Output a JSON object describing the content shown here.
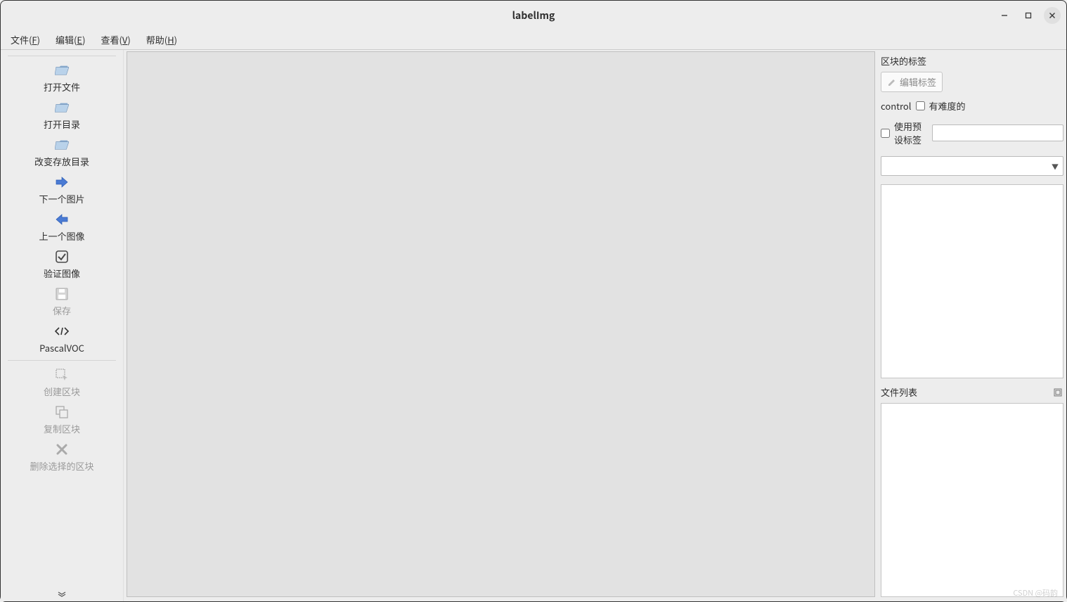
{
  "window": {
    "title": "labelImg"
  },
  "menubar": {
    "file": {
      "label": "文件(",
      "mnemonic": "F",
      "close": ")"
    },
    "edit": {
      "label": "编辑(",
      "mnemonic": "E",
      "close": ")"
    },
    "view": {
      "label": "查看(",
      "mnemonic": "V",
      "close": ")"
    },
    "help": {
      "label": "帮助(",
      "mnemonic": "H",
      "close": ")"
    }
  },
  "toolbar": {
    "open_file": "打开文件",
    "open_dir": "打开目录",
    "change_save_dir": "改变存放目录",
    "next_image": "下一个图片",
    "prev_image": "上一个图像",
    "verify_image": "验证图像",
    "save": "保存",
    "format": "PascalVOC",
    "create_box": "创建区块",
    "duplicate_box": "复制区块",
    "delete_box": "删除选择的区块"
  },
  "right_panel": {
    "box_labels_title": "区块的标签",
    "edit_label": "编辑标签",
    "difficult": "有难度的",
    "use_default_label": "使用预设标签",
    "default_label_value": "",
    "dropdown_value": "",
    "file_list_title": "文件列表"
  },
  "watermark": "CSDN @码韵"
}
